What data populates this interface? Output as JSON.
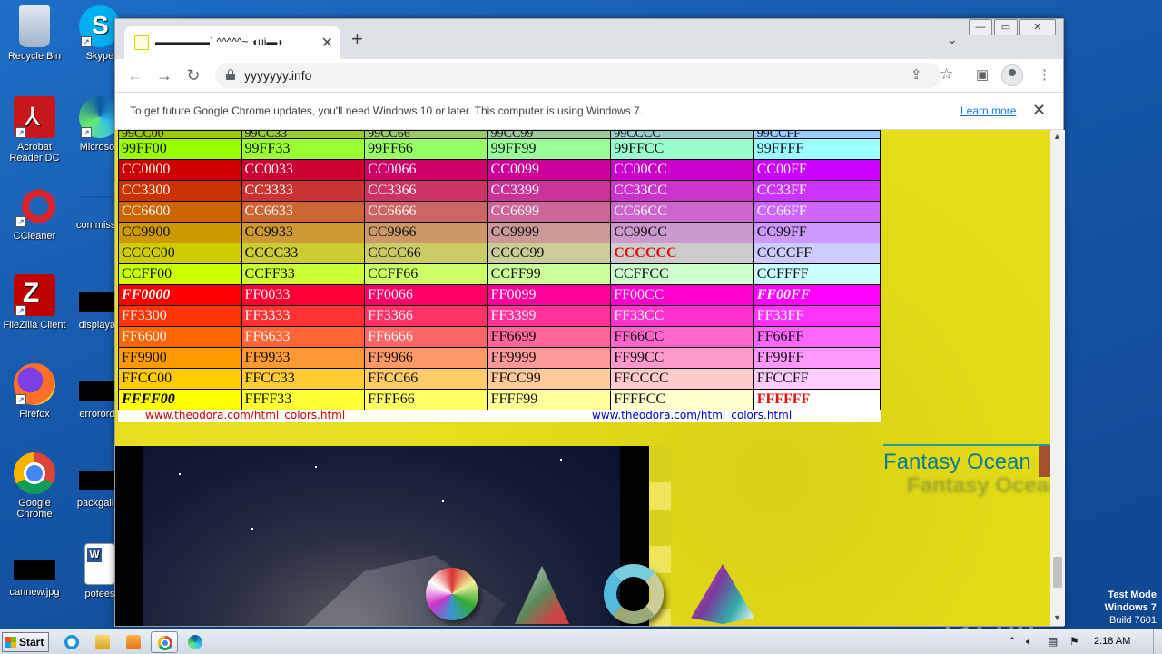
{
  "desktop": {
    "icons": [
      {
        "label": "Recycle Bin"
      },
      {
        "label": "Skype"
      },
      {
        "label": "Acrobat Reader DC"
      },
      {
        "label": "Microsoft"
      },
      {
        "label": "CCleaner"
      },
      {
        "label": "commissio"
      },
      {
        "label": "FileZilla Client"
      },
      {
        "label": "displayau"
      },
      {
        "label": "Firefox"
      },
      {
        "label": "errororde"
      },
      {
        "label": "Google Chrome"
      },
      {
        "label": "packgaller"
      },
      {
        "label": "cannew.jpg"
      },
      {
        "label": "pofees"
      }
    ],
    "watermark": "ANY RUN",
    "test_mode": {
      "line1": "Test Mode",
      "line2": "Windows 7",
      "line3": "Build 7601"
    }
  },
  "browser": {
    "tab_title": "▬▬▬▬▬` ^^^^^~ ◖ui▬◗",
    "tab_close": "✕",
    "new_tab": "+",
    "url": "yyyyyyy.info",
    "window_buttons": [
      "—",
      "▭",
      "✕"
    ],
    "infobar": {
      "message": "To get future Google Chrome updates, you'll need Windows 10 or later. This computer is using Windows 7.",
      "link": "Learn more",
      "close": "✕"
    }
  },
  "page": {
    "partial_row": [
      "99CC00",
      "99CC33",
      "99CC66",
      "99CC99",
      "99CCCC",
      "99CCFF"
    ],
    "rows": [
      {
        "cells": [
          "99FF00",
          "99FF33",
          "99FF66",
          "99FF99",
          "99FFCC",
          "99FFFF"
        ]
      },
      {
        "cells": [
          "CC0000",
          "CC0033",
          "CC0066",
          "CC0099",
          "CC00CC",
          "CC00FF"
        ]
      },
      {
        "cells": [
          "CC3300",
          "CC3333",
          "CC3366",
          "CC3399",
          "CC33CC",
          "CC33FF"
        ]
      },
      {
        "cells": [
          "CC6600",
          "CC6633",
          "CC6666",
          "CC6699",
          "CC66CC",
          "CC66FF"
        ]
      },
      {
        "cells": [
          "CC9900",
          "CC9933",
          "CC9966",
          "CC9999",
          "CC99CC",
          "CC99FF"
        ]
      },
      {
        "cells": [
          "CCCC00",
          "CCCC33",
          "CCCC66",
          "CCCC99",
          "CCCCCC",
          "CCCCFF"
        ]
      },
      {
        "cells": [
          "CCFF00",
          "CCFF33",
          "CCFF66",
          "CCFF99",
          "CCFFCC",
          "CCFFFF"
        ]
      },
      {
        "cells": [
          "FF0000",
          "FF0033",
          "FF0066",
          "FF0099",
          "FF00CC",
          "FF00FF"
        ]
      },
      {
        "cells": [
          "FF3300",
          "FF3333",
          "FF3366",
          "FF3399",
          "FF33CC",
          "FF33FF"
        ]
      },
      {
        "cells": [
          "FF6600",
          "FF6633",
          "FF6666",
          "FF6699",
          "FF66CC",
          "FF66FF"
        ]
      },
      {
        "cells": [
          "FF9900",
          "FF9933",
          "FF9966",
          "FF9999",
          "FF99CC",
          "FF99FF"
        ]
      },
      {
        "cells": [
          "FFCC00",
          "FFCC33",
          "FFCC66",
          "FFCC99",
          "FFCCCC",
          "FFCCFF"
        ]
      },
      {
        "cells": [
          "FFFF00",
          "FFFF33",
          "FFFF66",
          "FFFF99",
          "FFFFCC",
          "FFFFFF"
        ]
      }
    ],
    "link_left": "www.theodora.com/html_colors.html",
    "link_right": "www.theodora.com/html_colors.html",
    "fantasy_title": "Fantasy Ocean",
    "fantasy_shadow": "Fantasy Ocean"
  },
  "taskbar": {
    "start_label": "Start",
    "clock": "2:18 AM"
  }
}
